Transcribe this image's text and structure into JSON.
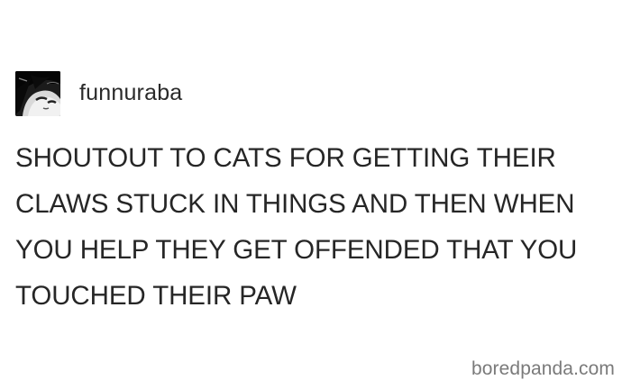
{
  "post": {
    "username": "funnuraba",
    "avatar_icon": "avatar-portrait-icon",
    "lines": [
      "SHOUTOUT TO CATS FOR GETTING THEIR",
      "CLAWS STUCK IN THINGS AND THEN WHEN",
      "YOU HELP THEY GET OFFENDED THAT YOU",
      "TOUCHED THEIR PAW"
    ]
  },
  "watermark": {
    "text": "boredpanda.com"
  },
  "colors": {
    "background": "#ffffff",
    "text": "#262626",
    "watermark": "#7a7a7a"
  }
}
